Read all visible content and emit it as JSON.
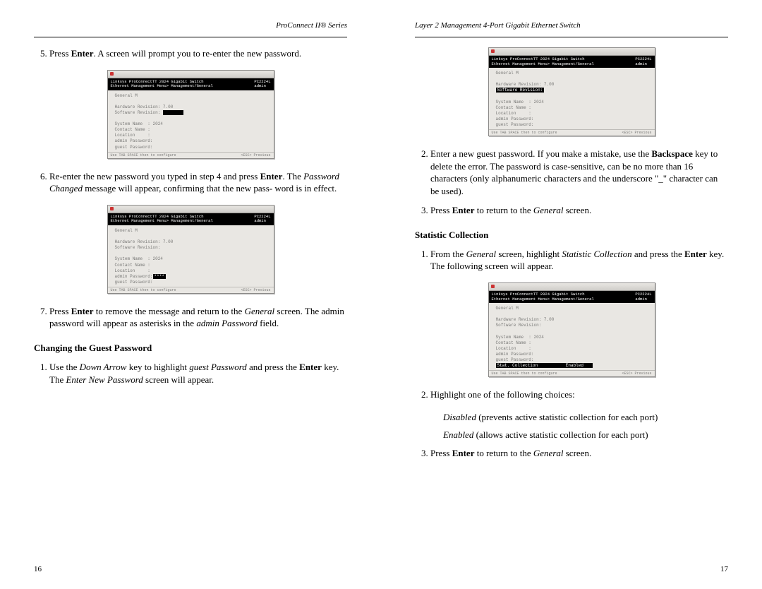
{
  "left": {
    "header": "ProConnect II® Series",
    "step5": {
      "pre": "Press ",
      "b": "Enter",
      "post": ". A screen will prompt you to re-enter the new password."
    },
    "step6": {
      "l1a": "Re-enter the new password you typed in step 4 and press ",
      "l1b": "Enter",
      "l1c": ". The ",
      "l2a": "Password Changed",
      "l2b": " message will appear, confirming that the new pass-",
      "l3": "word is in effect."
    },
    "step7": {
      "a": "Press ",
      "b": "Enter",
      "c": " to remove the message and return to the ",
      "d": "General",
      "e": " screen. The",
      "f": "admin password will appear as asterisks in the ",
      "g": "admin Password",
      "h": " field."
    },
    "sub": "Changing the Guest Password",
    "g1": {
      "a": "Use the ",
      "b": "Down Arrow",
      "c": " key to highlight ",
      "d": "guest Password",
      "e": " and press the ",
      "f": "Enter",
      "g": "key. The ",
      "h": "Enter New Password",
      "i": " screen will appear."
    },
    "shot_black_l": "Linksys ProConnectTT 2024 Gigabit Switch\nEthernet Management Menu> Management/General",
    "shot_black_r": "PC2224L\nadmin",
    "shot_body": [
      "General M",
      "",
      "Hardware Revision: 7.00",
      "Software Revision: [hl]       [/hl]",
      "",
      "System Name  : 2024",
      "Contact Name :",
      "Location     :",
      "admin Password:",
      "guest Password:"
    ],
    "shot_body2": [
      "General M",
      "",
      "Hardware Revision: 7.00",
      "Software Revision:",
      "",
      "System Name  : 2024",
      "Contact Name :",
      "Location     :",
      "admin Password:[hl]****[/hl]",
      "guest Password:"
    ],
    "shot_status_l": "Use TAB SPACE then to configure",
    "shot_status_r": "<ESC> Previous",
    "pgno": "16"
  },
  "right": {
    "header": "Layer 2 Management 4-Port Gigabit Ethernet Switch",
    "shot_body": [
      "General M",
      "",
      "Hardware Revision: 7.00",
      "[hl]Software Revision:[/hl]",
      "",
      "System Name  : 2024",
      "Contact Name :",
      "Location     :",
      "admin Password:",
      "guest Password:"
    ],
    "step2": {
      "a": "Enter a new guest password. If you make a mistake, use the ",
      "b": "Backspace",
      "c": "key to delete the error. The password is case-sensitive, can be no more than 16 characters (only alphanumeric characters and the underscore \"_\" character can be used)."
    },
    "step3": {
      "a": "Press ",
      "b": "Enter",
      "c": " to return to the ",
      "d": "General",
      "e": " screen."
    },
    "sub": "Statistic Collection",
    "sc1": {
      "a": "From the ",
      "b": "General",
      "c": " screen, highlight ",
      "d": "Statistic Collection",
      "e": " and press the ",
      "f": "Enter",
      "g": " key. The following screen will appear."
    },
    "sc_shot_body": [
      "General M",
      "",
      "Hardware Revision: 7.00",
      "Software Revision:",
      "",
      "System Name  : 2024",
      "Contact Name :",
      "Location     :",
      "admin Password:",
      "guest Password:",
      "[hl]Stat. Collection           Enabled   [/hl]"
    ],
    "sc2": "Highlight one of the following choices:",
    "sc2a_i": "Disabled",
    "sc2a_t": " (prevents active statistic collection for each port)",
    "sc2b_i": "Enabled",
    "sc2b_t": " (allows active statistic collection for each port)",
    "sc3": {
      "a": "Press ",
      "b": "Enter",
      "c": " to return to the ",
      "d": "General",
      "e": " screen."
    },
    "pgno": "17"
  }
}
